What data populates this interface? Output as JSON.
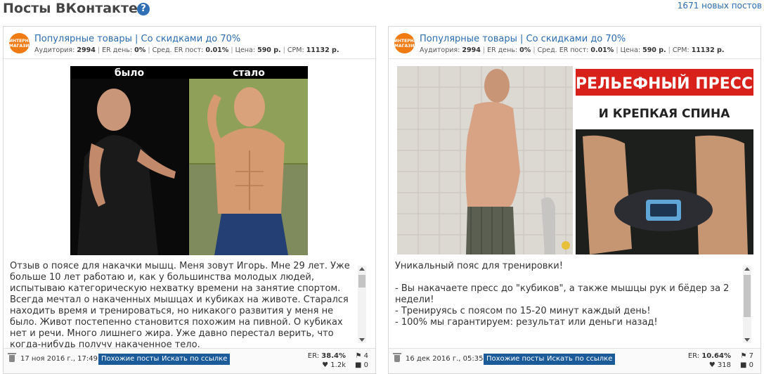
{
  "header": {
    "title": "Посты ВКонтакте",
    "help_icon": "?",
    "new_posts": "1671 новых постов"
  },
  "posts": [
    {
      "group_name": "Популярные товары | Со скидками до 70%",
      "avatar_text": "ИНТЕРНЕТ МАГАЗИН",
      "stats": {
        "audience_label": "Аудитория:",
        "audience": "2994",
        "er_day_label": "ER день:",
        "er_day": "0%",
        "er_post_label": "Сред. ER пост:",
        "er_post": "0.01%",
        "price_label": "Цена:",
        "price": "590 р.",
        "cpm_label": "CPM:",
        "cpm": "11132 р."
      },
      "image": {
        "label_before": "было",
        "label_after": "стало"
      },
      "text": "Отзыв о поясе для накачки мышц. Меня зовут Игорь. Мне 29 лет. Уже больше 10 лет работаю и, как у большинства молодых людей, испытываю категорическую нехватку времени на занятие спортом. Всегда мечтал о накаченных мышцах и кубиках на животе. Старался находить время и тренироваться, но никакого развития у меня не было. Живот постепенно становится похожим на пивной. О кубиках нет и речи. Много лишнего жира. Уже давно перестал верить, что когда-нибудь получу накаченное тело.",
      "date": "17 ноя 2016 г., 17:49",
      "similar_button": "Похожие посты",
      "search_button": "Искать по ссылке",
      "er_label": "ER:",
      "er_value": "38.4%",
      "likes": "1.2k",
      "reposts": "4",
      "comments": "0"
    },
    {
      "group_name": "Популярные товары | Со скидками до 70%",
      "avatar_text": "ИНТЕРНЕТ МАГАЗИН",
      "stats": {
        "audience_label": "Аудитория:",
        "audience": "2994",
        "er_day_label": "ER день:",
        "er_day": "0%",
        "er_post_label": "Сред. ER пост:",
        "er_post": "0.01%",
        "price_label": "Цена:",
        "price": "590 р.",
        "cpm_label": "CPM:",
        "cpm": "11132 р."
      },
      "image": {
        "banner_line1": "РЕЛЬЕФНЫЙ ПРЕСС",
        "banner_line2": "И КРЕПКАЯ СПИНА"
      },
      "text": "Уникальный пояс для тренировки!\n\n- Вы накачаете пресс до \"кубиков\", а также мышцы рук и бёдер за 2 недели!\n- Тренируясь с поясом по 15-20 минут каждый день!\n- 100% мы гарантируем: результат или деньги назад!",
      "date": "16 дек 2016 г., 05:35",
      "similar_button": "Похожие посты",
      "search_button": "Искать по ссылке",
      "er_label": "ER:",
      "er_value": "10.64%",
      "likes": "318",
      "reposts": "7",
      "comments": "0"
    }
  ],
  "colors": {
    "link": "#2a6bb0",
    "button": "#1b5b9a",
    "avatar": "#f07b12",
    "banner_red": "#d9211c"
  }
}
